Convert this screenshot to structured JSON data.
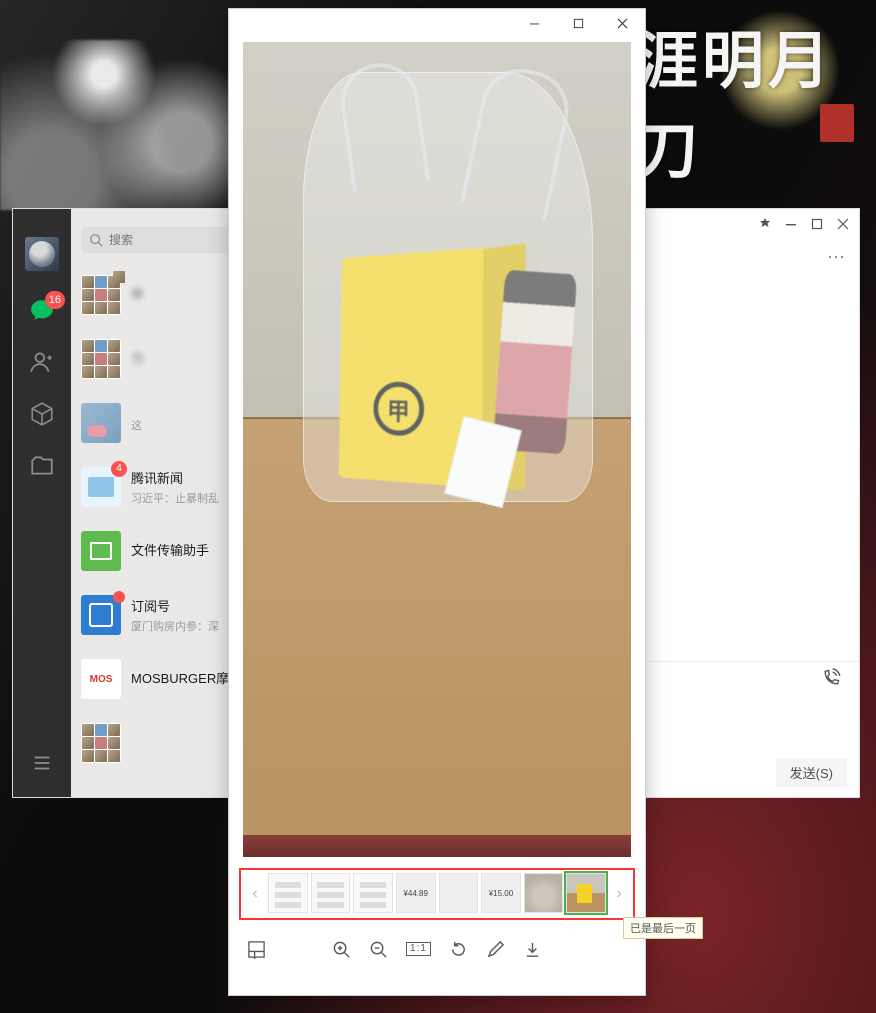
{
  "desktop": {
    "calligraphy": "涯明月刀"
  },
  "secondary_window": {
    "controls": {
      "pin": "pin-icon",
      "minimize": "minimize-icon",
      "maximize": "maximize-icon",
      "close": "close-icon"
    },
    "toolbar_more": "⋯",
    "send_label": "发送(S)"
  },
  "wechat": {
    "search_placeholder": "搜索",
    "sidebar": {
      "chat_badge": "16"
    },
    "conversations": [
      {
        "name": "伴",
        "preview": "",
        "avatar": "grid",
        "dot": true
      },
      {
        "name": "力",
        "preview": "",
        "avatar": "grid"
      },
      {
        "name": "",
        "preview": "这",
        "avatar": "img"
      },
      {
        "name": "腾讯新闻",
        "preview": "习近平：止暴制乱",
        "avatar": "news",
        "badge": "4"
      },
      {
        "name": "文件传输助手",
        "preview": "",
        "avatar": "file"
      },
      {
        "name": "订阅号",
        "preview": "厦门购房内参：深",
        "avatar": "sub",
        "dot": true
      },
      {
        "name": "MOSBURGER摩",
        "preview": "",
        "avatar": "mos"
      },
      {
        "name": "",
        "preview": "",
        "avatar": "grid"
      }
    ]
  },
  "viewer": {
    "ratio_label": "1:1",
    "thumbs": [
      {
        "kind": "doc"
      },
      {
        "kind": "doc"
      },
      {
        "kind": "doc"
      },
      {
        "kind": "price",
        "label": "¥44.89"
      },
      {
        "kind": "price",
        "label": ""
      },
      {
        "kind": "price",
        "label": "¥15.00"
      },
      {
        "kind": "pic1"
      },
      {
        "kind": "pic2",
        "selected": true
      }
    ],
    "tooltip": "已是最后一页"
  }
}
